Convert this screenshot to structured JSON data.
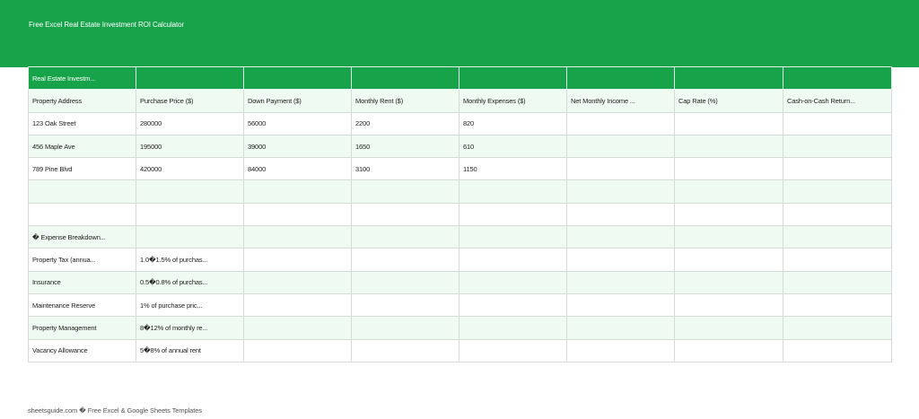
{
  "header": {
    "title": "Free Excel Real Estate Investment ROI Calculator"
  },
  "sheet": {
    "banner": "Real Estate Investm...",
    "columns": [
      "Property Address",
      "Purchase Price ($)",
      "Down Payment ($)",
      "Monthly Rent ($)",
      "Monthly Expenses ($)",
      "Net Monthly Income ...",
      "Cap Rate (%)",
      "Cash-on-Cash Return..."
    ],
    "properties": [
      [
        "123 Oak Street",
        "280000",
        "56000",
        "2200",
        "820",
        "",
        "",
        ""
      ],
      [
        "456 Maple Ave",
        "195000",
        "39000",
        "1650",
        "610",
        "",
        "",
        ""
      ],
      [
        "789 Pine Blvd",
        "420000",
        "84000",
        "3100",
        "1150",
        "",
        "",
        ""
      ]
    ],
    "expense_title": "� Expense Breakdown...",
    "expenses": [
      [
        "Property Tax (annua...",
        "1.0�1.5% of purchas..."
      ],
      [
        "Insurance",
        "0.5�0.8% of purchas..."
      ],
      [
        "Maintenance Reserve",
        "1% of purchase pric..."
      ],
      [
        "Property Management",
        "8�12% of monthly re..."
      ],
      [
        "Vacancy Allowance",
        "5�8% of annual rent"
      ]
    ]
  },
  "footer": {
    "text": "sheetsguide.com � Free Excel & Google Sheets Templates"
  }
}
